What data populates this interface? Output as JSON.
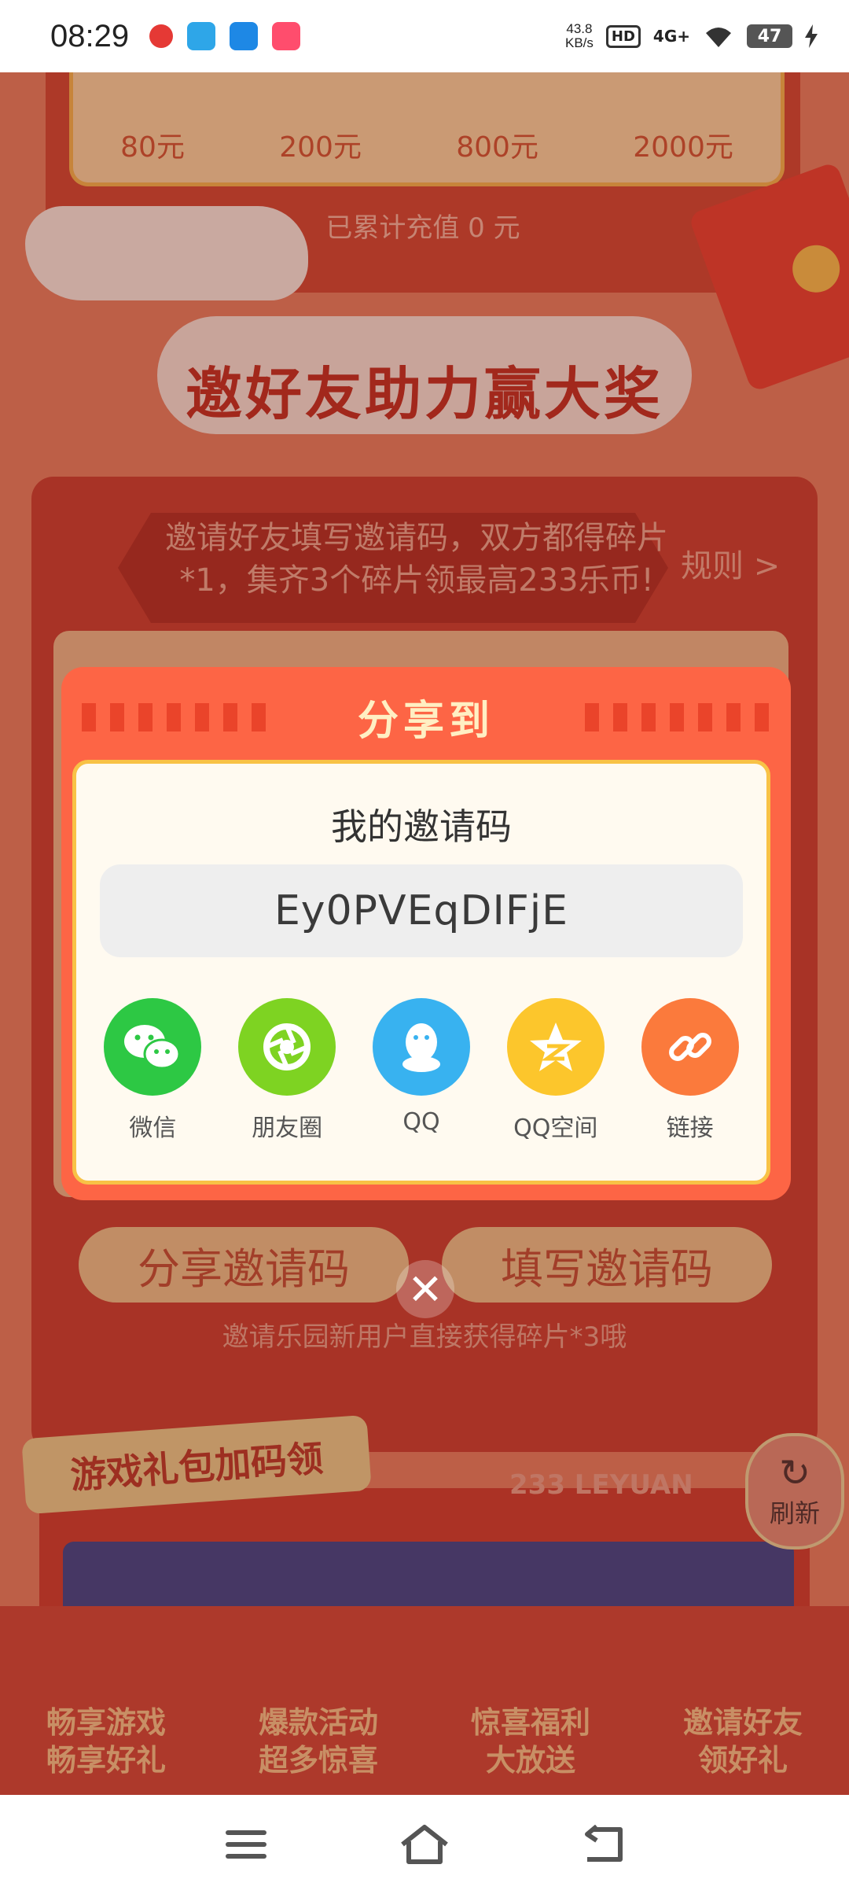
{
  "status_bar": {
    "time": "08:29",
    "net_speed_value": "43.8",
    "net_speed_unit": "KB/s",
    "hd": "HD",
    "network": "4G+",
    "battery": "47",
    "app_icons": [
      "record-icon",
      "telegram-icon",
      "store-icon",
      "game-icon"
    ]
  },
  "background": {
    "tiers": [
      "80元",
      "200元",
      "800元",
      "2000元"
    ],
    "cumulative": "已累计充值 0 元",
    "banner_title": "邀好友助力赢大奖",
    "invite_desc": "邀请好友填写邀请码，双方都得碎片*1，集齐3个碎片领最高233乐币!",
    "rules": "规则 >",
    "share_code_button": "分享邀请码",
    "fill_code_button": "填写邀请码",
    "hint": "邀请乐园新用户直接获得碎片*3哦",
    "gift_tag": "游戏礼包加码领",
    "brand_text": "233 LEYUAN",
    "refresh": "刷新",
    "bottom_tiles": [
      {
        "line1": "畅享游戏",
        "line2": "畅享好礼"
      },
      {
        "line1": "爆款活动",
        "line2": "超多惊喜"
      },
      {
        "line1": "惊喜福利",
        "line2": "大放送"
      },
      {
        "line1": "邀请好友",
        "line2": "领好礼"
      }
    ]
  },
  "modal": {
    "title": "分享到",
    "code_label": "我的邀请码",
    "invite_code": "Ey0PVEqDIFjE",
    "share_targets": [
      {
        "label": "微信",
        "icon": "wechat-icon",
        "color": "#2dc844"
      },
      {
        "label": "朋友圈",
        "icon": "moments-icon",
        "color": "#7ed322"
      },
      {
        "label": "QQ",
        "icon": "qq-icon",
        "color": "#38b2f0"
      },
      {
        "label": "QQ空间",
        "icon": "qzone-icon",
        "color": "#fcc62c"
      },
      {
        "label": "链接",
        "icon": "link-icon",
        "color": "#fb7a3c"
      }
    ]
  },
  "close_icon": "close-icon",
  "nav": {
    "icons": [
      "menu-icon",
      "home-icon",
      "back-icon"
    ]
  }
}
